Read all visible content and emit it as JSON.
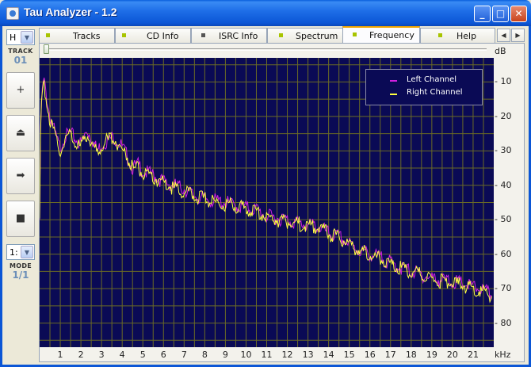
{
  "window": {
    "title": "Tau Analyzer - 1.2"
  },
  "left_panel": {
    "top_select_value": "H",
    "track_label": "TRACK",
    "track_value": "01",
    "mode_select_value": "1:",
    "mode_label": "MODE",
    "mode_value": "1/1",
    "buttons": [
      {
        "name": "add",
        "glyph": "+"
      },
      {
        "name": "eject",
        "glyph": "⏏"
      },
      {
        "name": "play",
        "glyph": "➡"
      },
      {
        "name": "stop",
        "glyph": "■"
      }
    ]
  },
  "tabs": [
    {
      "label": "Tracks",
      "icon_color": "#a8c400"
    },
    {
      "label": "CD Info",
      "icon_color": "#a8c400"
    },
    {
      "label": "ISRC Info",
      "icon_color": "#555555"
    },
    {
      "label": "Spectrum",
      "icon_color": "#a8c400"
    },
    {
      "label": "Frequency",
      "icon_color": "#a8c400",
      "active": true
    },
    {
      "label": "Help",
      "icon_color": "#a8c400"
    }
  ],
  "units": {
    "y": "dB",
    "x": "kHz"
  },
  "chart_data": {
    "type": "line",
    "xlabel": "kHz",
    "ylabel": "dB",
    "xlim": [
      0,
      22
    ],
    "ylim": [
      -87,
      -3
    ],
    "y_ticks": [
      "10",
      "20",
      "30",
      "40",
      "50",
      "60",
      "70",
      "80"
    ],
    "x_ticks": [
      "1",
      "2",
      "3",
      "4",
      "5",
      "6",
      "7",
      "8",
      "9",
      "10",
      "11",
      "12",
      "13",
      "14",
      "15",
      "16",
      "17",
      "18",
      "19",
      "20",
      "21"
    ],
    "grid": true,
    "background": "#0a0a55",
    "grid_color": "#6b6b25",
    "legend_position": "top-right",
    "series": [
      {
        "name": "Left Channel",
        "color": "#d020e0",
        "x": [
          0,
          0.05,
          0.1,
          0.2,
          0.3,
          0.5,
          0.7,
          0.9,
          1.0,
          1.2,
          1.5,
          1.8,
          2.0,
          2.3,
          2.5,
          2.8,
          3.0,
          3.3,
          3.6,
          3.9,
          4.2,
          4.5,
          4.8,
          5.0,
          5.5,
          6.0,
          6.5,
          7.0,
          7.5,
          8.0,
          8.5,
          9.0,
          9.5,
          10.0,
          10.5,
          11.0,
          11.5,
          12.0,
          12.5,
          13.0,
          13.5,
          14.0,
          14.5,
          15.0,
          15.5,
          16.0,
          16.5,
          17.0,
          17.5,
          18.0,
          18.5,
          19.0,
          19.5,
          20.0,
          20.5,
          21.0,
          21.5,
          21.9
        ],
        "y": [
          -50,
          -22,
          -15,
          -9,
          -13,
          -20,
          -24,
          -28,
          -29,
          -26,
          -25,
          -27,
          -28,
          -24,
          -26,
          -30,
          -28,
          -27,
          -26,
          -28,
          -31,
          -35,
          -34,
          -36,
          -37,
          -39,
          -40,
          -41,
          -43,
          -44,
          -44.5,
          -45,
          -46,
          -46.5,
          -47,
          -49,
          -49.5,
          -50,
          -51,
          -51.5,
          -52,
          -54,
          -55,
          -57,
          -59,
          -60,
          -61,
          -62.5,
          -64,
          -65,
          -66,
          -67,
          -67.5,
          -68,
          -68.5,
          -69.5,
          -70.5,
          -72
        ]
      },
      {
        "name": "Right Channel",
        "color": "#ffff40",
        "x": [
          0,
          0.05,
          0.1,
          0.2,
          0.3,
          0.5,
          0.7,
          0.9,
          1.0,
          1.2,
          1.5,
          1.8,
          2.0,
          2.3,
          2.5,
          2.8,
          3.0,
          3.3,
          3.6,
          3.9,
          4.2,
          4.5,
          4.8,
          5.0,
          5.5,
          6.0,
          6.5,
          7.0,
          7.5,
          8.0,
          8.5,
          9.0,
          9.5,
          10.0,
          10.5,
          11.0,
          11.5,
          12.0,
          12.5,
          13.0,
          13.5,
          14.0,
          14.5,
          15.0,
          15.5,
          16.0,
          16.5,
          17.0,
          17.5,
          18.0,
          18.5,
          19.0,
          19.5,
          20.0,
          20.5,
          21.0,
          21.5,
          21.9
        ],
        "y": [
          -51,
          -23,
          -16,
          -10,
          -14,
          -21,
          -25,
          -29,
          -30,
          -27,
          -25,
          -28,
          -29,
          -25,
          -27,
          -31,
          -28,
          -27,
          -26,
          -29,
          -31,
          -35,
          -35,
          -37,
          -38,
          -39,
          -41,
          -42,
          -43,
          -44,
          -45,
          -45.5,
          -46,
          -47,
          -47.5,
          -49,
          -50,
          -50.5,
          -51,
          -52,
          -52.5,
          -54,
          -55.5,
          -57,
          -59,
          -60,
          -61.5,
          -63,
          -64,
          -65,
          -66,
          -67,
          -68,
          -68.5,
          -69,
          -70,
          -71,
          -72
        ]
      }
    ]
  }
}
